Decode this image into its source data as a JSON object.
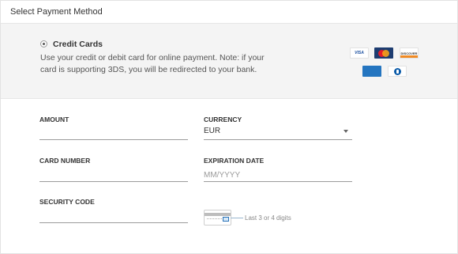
{
  "header": {
    "title": "Select Payment Method"
  },
  "payment_method": {
    "title": "Credit Cards",
    "description": "Use your credit or debit card for online payment. Note: if your card is supporting 3DS, you will be redirected to your bank.",
    "logos": [
      "VISA",
      "MasterCard",
      "DISCOVER",
      "AMERICAN EXPRESS",
      "Diners Club"
    ]
  },
  "form": {
    "amount_label": "AMOUNT",
    "amount_value": "",
    "currency_label": "CURRENCY",
    "currency_value": "EUR",
    "card_number_label": "CARD NUMBER",
    "card_number_value": "",
    "expiration_label": "EXPIRATION DATE",
    "expiration_placeholder": "MM/YYYY",
    "security_label": "SECURITY CODE",
    "security_value": "",
    "security_hint": "Last 3 or 4 digits"
  }
}
